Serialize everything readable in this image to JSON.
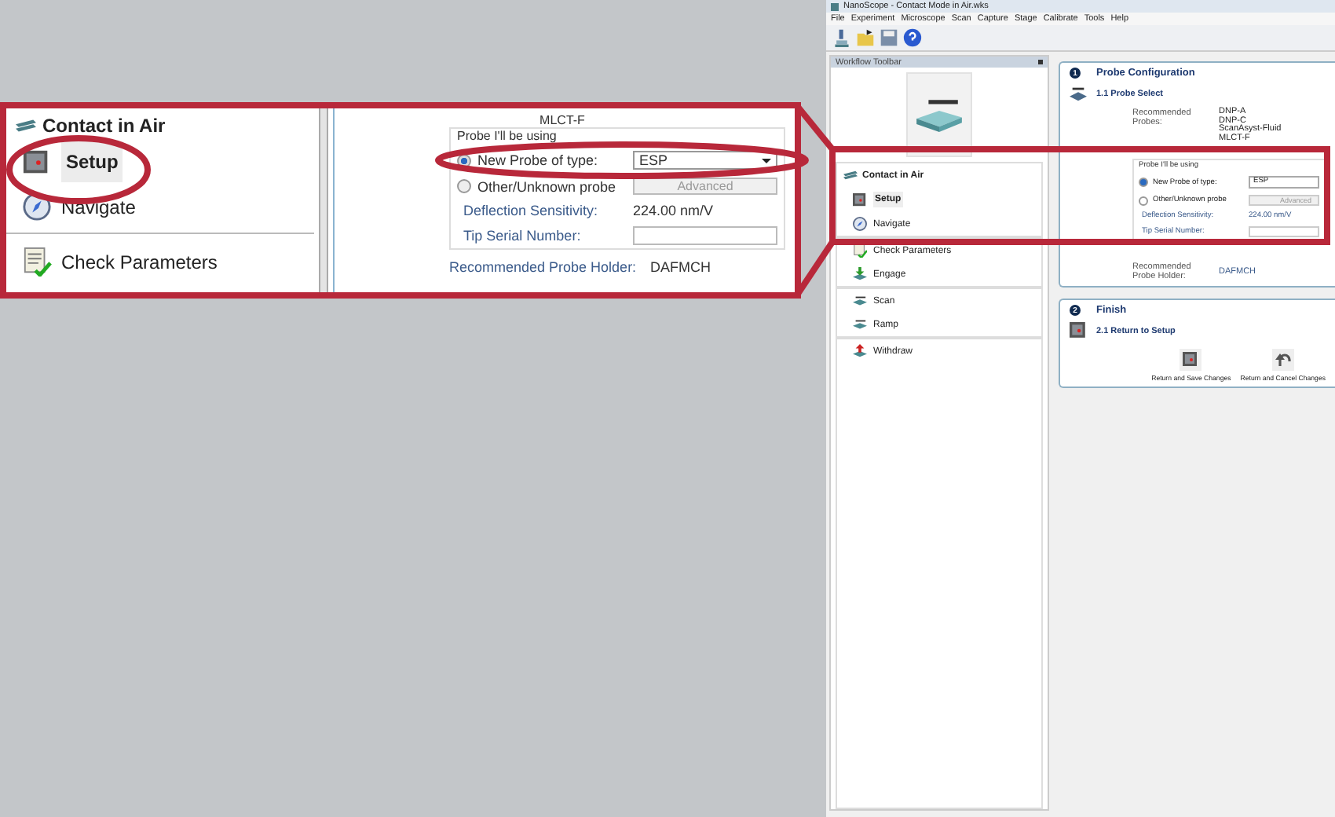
{
  "callout": {
    "group_title": "Contact in Air",
    "items": [
      {
        "label": "Setup",
        "selected": true
      },
      {
        "label": "Navigate",
        "selected": false
      },
      {
        "label": "Check Parameters",
        "selected": false
      }
    ],
    "form": {
      "probe_cut": "MLCT-F",
      "group_label": "Probe I'll be using",
      "options": [
        {
          "label": "New Probe of type:",
          "selected": true
        },
        {
          "label": "Other/Unknown probe",
          "selected": false
        }
      ],
      "probe_type": "ESP",
      "advanced_button": {
        "label": "Advanced",
        "disabled": true
      },
      "deflection_label": "Deflection Sensitivity:",
      "deflection_value": "224.00 nm/V",
      "serial_label": "Tip Serial Number:",
      "holder_label": "Recommended Probe Holder:",
      "holder_value": "DAFMCH"
    }
  },
  "window": {
    "title": "NanoScope - Contact Mode in Air.wks",
    "menu": [
      "File",
      "Experiment",
      "Microscope",
      "Scan",
      "Capture",
      "Stage",
      "Calibrate",
      "Tools",
      "Help"
    ],
    "workflow_title": "Workflow Toolbar",
    "sidebar": {
      "groups": [
        {
          "title": "Contact in Air",
          "items": [
            {
              "label": "Setup",
              "selected": true
            },
            {
              "label": "Navigate",
              "selected": false
            }
          ]
        },
        {
          "items": [
            {
              "label": "Check Parameters",
              "selected": false
            },
            {
              "label": "Engage",
              "selected": false
            }
          ]
        },
        {
          "items": [
            {
              "label": "Scan",
              "selected": false
            },
            {
              "label": "Ramp",
              "selected": false
            }
          ]
        },
        {
          "items": [
            {
              "label": "Withdraw",
              "selected": false
            }
          ]
        }
      ]
    },
    "sections": [
      {
        "number": "1",
        "title": "Probe Configuration",
        "step": "1.1 Probe Select",
        "probes_label": "Recommended Probes:",
        "probes": [
          "DNP-A",
          "DNP-C",
          "ScanAsyst-Fluid",
          "MLCT-F"
        ],
        "group_label": "Probe I'll be using",
        "options": [
          {
            "label": "New Probe of type:",
            "selected": true
          },
          {
            "label": "Other/Unknown probe",
            "selected": false
          }
        ],
        "probe_type": "ESP",
        "advanced_button": {
          "label": "Advanced",
          "disabled": true
        },
        "deflection_label": "Deflection Sensitivity:",
        "deflection_value": "224.00 nm/V",
        "serial_label": "Tip Serial Number:",
        "holder_label": "Recommended Probe Holder:",
        "holder_value": "DAFMCH"
      },
      {
        "number": "2",
        "title": "Finish",
        "step": "2.1 Return to Setup",
        "actions": [
          "Return and Save Changes",
          "Return and Cancel Changes"
        ]
      }
    ]
  }
}
